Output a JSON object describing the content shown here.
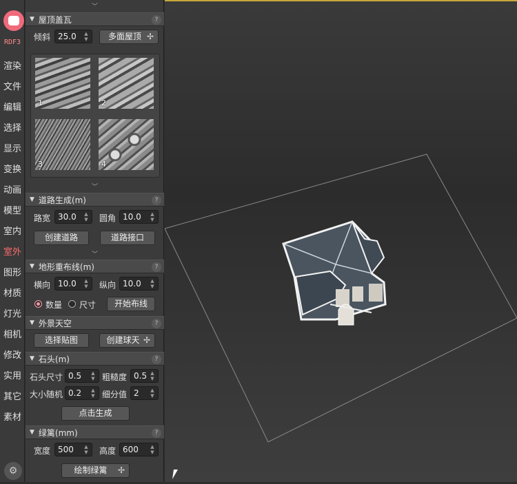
{
  "sidebar": {
    "brand": "RDF3",
    "items": [
      "渲染",
      "文件",
      "编辑",
      "选择",
      "显示",
      "变换",
      "动画",
      "模型",
      "室内",
      "室外",
      "图形",
      "材质",
      "灯光",
      "相机",
      "修改",
      "实用",
      "其它",
      "素材"
    ],
    "active": "室外"
  },
  "roof": {
    "title": "屋顶盖瓦",
    "tilt_label": "倾斜",
    "tilt_value": "25.0",
    "multi_button": "多面屋顶",
    "tiles": [
      "1",
      "2",
      "3",
      "4"
    ]
  },
  "road": {
    "title": "道路生成(m)",
    "width_label": "路宽",
    "width_value": "30.0",
    "corner_label": "圆角",
    "corner_value": "10.0",
    "create_button": "创建道路",
    "joint_button": "道路接口"
  },
  "terrain": {
    "title": "地形重布线(m)",
    "h_label": "横向",
    "h_value": "10.0",
    "v_label": "纵向",
    "v_value": "10.0",
    "opt_count": "数量",
    "opt_size": "尺寸",
    "start_button": "开始布线"
  },
  "sky": {
    "title": "外景天空",
    "pick_button": "选择贴图",
    "create_button": "创建球天"
  },
  "stone": {
    "title": "石头(m)",
    "size_label": "石头尺寸",
    "size_value": "0.5",
    "rough_label": "粗糙度",
    "rough_value": "0.5",
    "rand_label": "大小随机",
    "rand_value": "0.2",
    "sub_label": "细分值",
    "sub_value": "2",
    "gen_button": "点击生成"
  },
  "hedge": {
    "title": "绿篱(mm)",
    "w_label": "宽度",
    "w_value": "500",
    "h_label": "高度",
    "h_value": "600",
    "draw_button": "绘制绿篱"
  },
  "help_glyph": "?",
  "colors": {
    "accent": "#f06a7c",
    "active_nav": "#ff6b6b",
    "viewport_top_border": "#c8a83c"
  }
}
